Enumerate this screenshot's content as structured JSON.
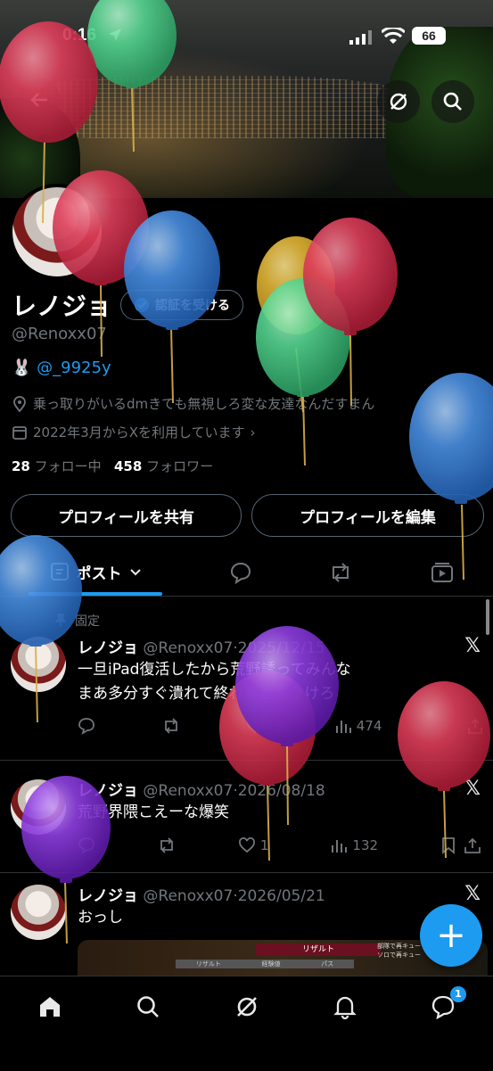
{
  "status_bar": {
    "time": "0:16",
    "battery": "66"
  },
  "profile": {
    "name": "レノジョ",
    "verify_label": "認証を受ける",
    "handle": "@Renoxx07",
    "bio_link_prefix": "🐰",
    "bio_link": "@_9925y",
    "location": "乗っ取りがいるdmきても無視しろ変な友達なんだすまん",
    "joined": "2022年3月からXを利用しています",
    "following_count": "28",
    "following_label": "フォロー中",
    "followers_count": "458",
    "followers_label": "フォロワー",
    "share_button": "プロフィールを共有",
    "edit_button": "プロフィールを編集"
  },
  "tabs": {
    "active": "ポスト"
  },
  "pinned_label": "固定",
  "posts": [
    {
      "name": "レノジョ",
      "handle": "@Renoxx07",
      "date": "2025/12/15",
      "text_line1": "一旦iPad復活したから荒野誘ってみんな",
      "text_line2": "まあ多分すぐ潰れて終わると思うけろ",
      "replies": "",
      "reposts": "",
      "likes": "",
      "views": "474"
    },
    {
      "name": "レノジョ",
      "handle": "@Renoxx07",
      "date": "2026/08/18",
      "text_line1": "荒野界隈こえーな爆笑",
      "text_line2": "",
      "replies": "",
      "reposts": "",
      "likes": "1",
      "views": "132"
    },
    {
      "name": "レノジョ",
      "handle": "@Renoxx07",
      "date": "2026/05/21",
      "text_line1": "おっし",
      "text_line2": ""
    }
  ],
  "media": {
    "tag": "リザルト",
    "strip": [
      "リザルト",
      "経験値",
      "パス"
    ],
    "side1": "部隊で再キュー",
    "side2": "ソロで再キュー"
  },
  "nav": {
    "messages_badge": "1"
  },
  "colors": {
    "accent": "#1d9bf0",
    "balloon_red": "#d9344f",
    "balloon_green": "#4cd28a",
    "balloon_blue": "#3b86e0",
    "balloon_yellow": "#e0b431",
    "balloon_purple": "#8a2be2"
  }
}
